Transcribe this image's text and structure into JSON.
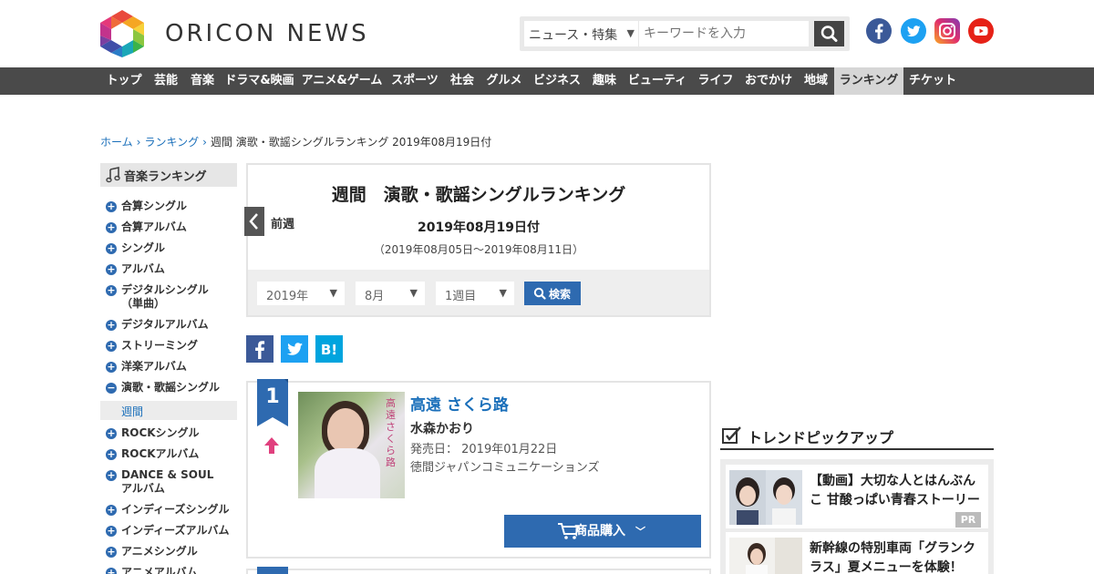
{
  "header": {
    "logo_text": "ORICON NEWS",
    "search_category": "ニュース・特集",
    "search_placeholder": "キーワードを入力",
    "sns": [
      "facebook-icon",
      "twitter-icon",
      "instagram-icon",
      "youtube-icon"
    ]
  },
  "nav": {
    "items": [
      "トップ",
      "芸能",
      "音楽",
      "ドラマ&映画",
      "アニメ&ゲーム",
      "スポーツ",
      "社会",
      "グルメ",
      "ビジネス",
      "趣味",
      "ビューティ",
      "ライフ",
      "おでかけ",
      "地域",
      "ランキング",
      "チケット"
    ],
    "active": "ランキング"
  },
  "breadcrumb": {
    "home": "ホーム",
    "ranking": "ランキング",
    "current": "週間 演歌・歌謡シングルランキング 2019年08月19日付"
  },
  "sidebar": {
    "title": "音楽ランキング",
    "items": [
      {
        "label": "合算シングル"
      },
      {
        "label": "合算アルバム"
      },
      {
        "label": "シングル"
      },
      {
        "label": "アルバム"
      },
      {
        "label": "デジタルシングル",
        "label2": "（単曲）"
      },
      {
        "label": "デジタルアルバム"
      },
      {
        "label": "ストリーミング"
      },
      {
        "label": "洋楽アルバム"
      },
      {
        "label": "演歌・歌謡シングル"
      },
      {
        "label": "ROCKシングル"
      },
      {
        "label": "ROCKアルバム"
      },
      {
        "label": "DANCE & SOUL",
        "label2": "アルバム"
      },
      {
        "label": "インディーズシングル"
      },
      {
        "label": "インディーズアルバム"
      },
      {
        "label": "アニメシングル"
      },
      {
        "label": "アニメアルバム"
      }
    ],
    "sub_item": "週間"
  },
  "ranking": {
    "title": "週間　演歌・歌謡シングルランキング",
    "prev_label": "前週",
    "date": "2019年08月19日付",
    "range": "（2019年08月05日～2019年08月11日）",
    "filter": {
      "year": "2019年",
      "month": "8月",
      "week": "1週目",
      "search_label": "検索"
    }
  },
  "share": [
    "facebook-share",
    "twitter-share",
    "hatena-bookmark"
  ],
  "entries": [
    {
      "rank": "1",
      "title": "高遠 さくら路",
      "artist": "水森かおり",
      "release": "発売日：  2019年01月22日",
      "label": "徳間ジャパンコミュニケーションズ",
      "buy_label": "商品購入",
      "jacket_text": "高遠さくら路"
    }
  ],
  "trend": {
    "title": "トレンドピックアップ",
    "items": [
      {
        "text": "【動画】大切な人とはんぶんこ 甘酸っぱい青春ストーリー",
        "badge": "PR"
      },
      {
        "text": "新幹線の特別車両「グランクラス」夏メニューを体験！"
      }
    ]
  },
  "colors": {
    "accent": "#2e6ab0",
    "nav_bg": "#4a4a4a",
    "link": "#1a6fba",
    "rank_up": "#e0407e"
  }
}
